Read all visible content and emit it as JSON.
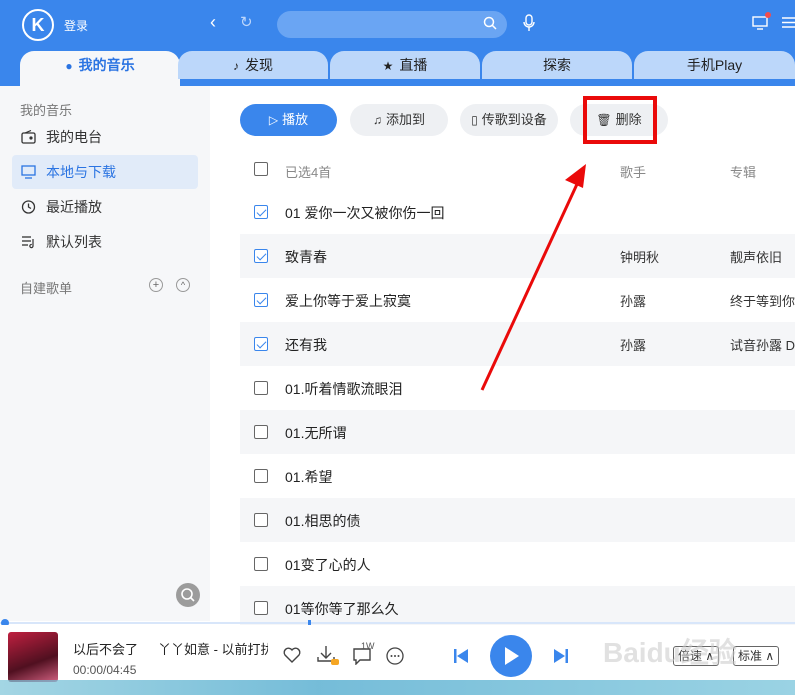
{
  "header": {
    "logo": "K",
    "login": "登录",
    "accent": "#3a86ec"
  },
  "tabs": [
    {
      "label": "我的音乐",
      "icon": "user-icon"
    },
    {
      "label": "发现",
      "icon": "note-icon"
    },
    {
      "label": "直播",
      "icon": "star-icon"
    },
    {
      "label": "探索",
      "icon": ""
    },
    {
      "label": "手机Play",
      "icon": ""
    }
  ],
  "sidebar": {
    "section_title": "我的音乐",
    "items": [
      {
        "label": "我的电台",
        "icon": "radio-icon"
      },
      {
        "label": "本地与下载",
        "icon": "monitor-icon"
      },
      {
        "label": "最近播放",
        "icon": "clock-icon"
      },
      {
        "label": "默认列表",
        "icon": "list-icon"
      }
    ],
    "playlist_section": "自建歌单",
    "add": "+",
    "collapse": "^"
  },
  "toolbar": {
    "play": "播放",
    "add_to": "添加到",
    "transfer": "传歌到设备",
    "delete": "删除"
  },
  "table": {
    "selected": "已选4首",
    "col_artist": "歌手",
    "col_album": "专辑",
    "rows": [
      {
        "title": "01 爱你一次又被你伤一回",
        "artist": "",
        "album": "",
        "checked": true
      },
      {
        "title": "致青春",
        "artist": "钟明秋",
        "album": "靓声依旧",
        "checked": true
      },
      {
        "title": "爱上你等于爱上寂寞",
        "artist": "孙露",
        "album": "终于等到你",
        "checked": true
      },
      {
        "title": "还有我",
        "artist": "孙露",
        "album": "试音孙露 D",
        "checked": true
      },
      {
        "title": "01.听着情歌流眼泪",
        "artist": "",
        "album": "",
        "checked": false
      },
      {
        "title": "01.无所谓",
        "artist": "",
        "album": "",
        "checked": false
      },
      {
        "title": "01.希望",
        "artist": "",
        "album": "",
        "checked": false
      },
      {
        "title": "01.相思的债",
        "artist": "",
        "album": "",
        "checked": false
      },
      {
        "title": "01变了心的人",
        "artist": "",
        "album": "",
        "checked": false
      },
      {
        "title": "01等你等了那么久",
        "artist": "",
        "album": "",
        "checked": false
      }
    ]
  },
  "player": {
    "song": "以后不会了",
    "lyric": "丫丫如意 - 以前打扰",
    "time": "00:00/04:45",
    "comment_count": "1W",
    "speed": "倍速",
    "quality": "标准",
    "progress": 0.0
  },
  "watermark": "Baidu经验"
}
